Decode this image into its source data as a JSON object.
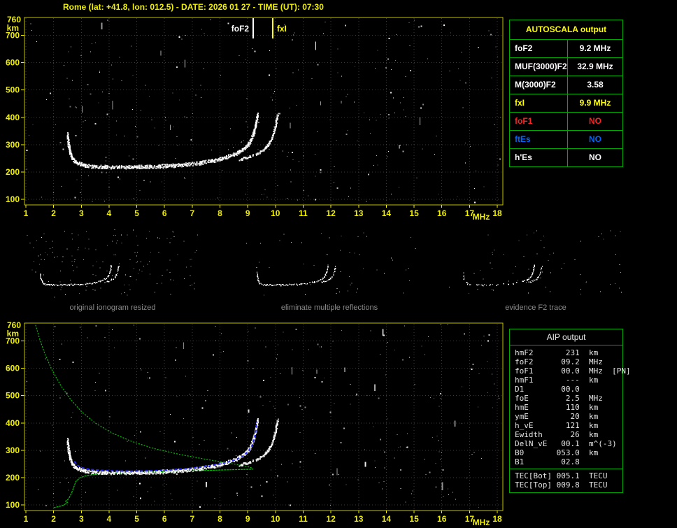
{
  "title": "Rome (lat: +41.8, lon: 012.5) - DATE: 2026 01 27 - TIME (UT): 07:30",
  "colors": {
    "axis": "#f0f000",
    "plot_border": "#c0c000",
    "grid": "#3c3c3c",
    "table_border": "#00aa00",
    "caption": "#8c8c8c",
    "white": "#ffffff",
    "yellow": "#ffff00",
    "red": "#ff2222",
    "blue": "#0066ff",
    "green": "#00c400",
    "blue_curve": "#2a2aff"
  },
  "autoscala_table": {
    "header": "AUTOSCALA output",
    "rows": [
      {
        "label": "foF2",
        "value": "9.2 MHz",
        "color": "white"
      },
      {
        "label": "MUF(3000)F2",
        "value": "32.9 MHz",
        "color": "white"
      },
      {
        "label": "M(3000)F2",
        "value": "3.58",
        "color": "white"
      },
      {
        "label": "fxI",
        "value": "9.9 MHz",
        "color": "yellow"
      },
      {
        "label": "foF1",
        "value": "NO",
        "color": "red"
      },
      {
        "label": "ftEs",
        "value": "NO",
        "color": "blue"
      },
      {
        "label": "h'Es",
        "value": "NO",
        "color": "white"
      }
    ]
  },
  "thumbnails": [
    {
      "caption": "original ionogram resized"
    },
    {
      "caption": "eliminate multiple reflections"
    },
    {
      "caption": "evidence F2 trace"
    }
  ],
  "aip_table": {
    "header": "AIP output",
    "rows": [
      {
        "label": "hmF2",
        "value": "231",
        "unit": "km",
        "extra": ""
      },
      {
        "label": "foF2",
        "value": "09.2",
        "unit": "MHz",
        "extra": ""
      },
      {
        "label": "foF1",
        "value": "00.0",
        "unit": "MHz",
        "extra": "[PN]"
      },
      {
        "label": "hmF1",
        "value": "---",
        "unit": "km",
        "extra": ""
      },
      {
        "label": "D1",
        "value": "00.0",
        "unit": "",
        "extra": ""
      },
      {
        "label": "foE",
        "value": "2.5",
        "unit": "MHz",
        "extra": ""
      },
      {
        "label": "hmE",
        "value": "110",
        "unit": "km",
        "extra": ""
      },
      {
        "label": "ymE",
        "value": "20",
        "unit": "km",
        "extra": ""
      },
      {
        "label": "h_vE",
        "value": "121",
        "unit": "km",
        "extra": ""
      },
      {
        "label": "Ewidth",
        "value": "26",
        "unit": "km",
        "extra": ""
      },
      {
        "label": "DelN_vE",
        "value": "00.1",
        "unit": "m^(-3)",
        "extra": ""
      },
      {
        "label": "B0",
        "value": "053.0",
        "unit": "km",
        "extra": ""
      },
      {
        "label": "B1",
        "value": "02.8",
        "unit": "",
        "extra": ""
      }
    ],
    "tec_rows": [
      {
        "label": "TEC[Bot]",
        "value": "005.1",
        "unit": "TECU"
      },
      {
        "label": "TEC[Top]",
        "value": "009.8",
        "unit": "TECU"
      }
    ]
  },
  "chart_data": {
    "type": "scatter",
    "title": "ionogram",
    "x_axis": {
      "unit": "MHz",
      "min": 1,
      "max": 18,
      "ticks": [
        1,
        2,
        3,
        4,
        5,
        6,
        7,
        8,
        9,
        10,
        11,
        12,
        13,
        14,
        15,
        16,
        17,
        18
      ]
    },
    "y_axis": {
      "unit": "km",
      "top_label": "760",
      "min": 80,
      "max": 765,
      "grid": [
        100,
        200,
        300,
        400,
        500,
        600,
        700
      ]
    },
    "markers": [
      {
        "label": "foF2",
        "mhz": 9.2,
        "color": "white",
        "side": "left"
      },
      {
        "label": "fxI",
        "mhz": 9.9,
        "color": "yellow",
        "side": "right"
      }
    ],
    "series": {
      "o_trace": [
        [
          2.48,
          345
        ],
        [
          2.52,
          310
        ],
        [
          2.58,
          278
        ],
        [
          2.65,
          258
        ],
        [
          2.75,
          245
        ],
        [
          2.9,
          236
        ],
        [
          3.1,
          230
        ],
        [
          3.4,
          227
        ],
        [
          3.8,
          225
        ],
        [
          4.3,
          224
        ],
        [
          4.8,
          224
        ],
        [
          5.3,
          225
        ],
        [
          5.8,
          227
        ],
        [
          6.3,
          230
        ],
        [
          6.8,
          234
        ],
        [
          7.3,
          240
        ],
        [
          7.7,
          247
        ],
        [
          8.0,
          254
        ],
        [
          8.3,
          263
        ],
        [
          8.6,
          275
        ],
        [
          8.8,
          288
        ],
        [
          9.0,
          306
        ],
        [
          9.1,
          322
        ],
        [
          9.2,
          348
        ],
        [
          9.27,
          378
        ],
        [
          9.32,
          405
        ],
        [
          9.34,
          416
        ]
      ],
      "x_trace": [
        [
          8.7,
          250
        ],
        [
          9.0,
          258
        ],
        [
          9.3,
          270
        ],
        [
          9.55,
          285
        ],
        [
          9.7,
          300
        ],
        [
          9.85,
          325
        ],
        [
          9.95,
          358
        ],
        [
          10.02,
          392
        ],
        [
          10.06,
          414
        ]
      ],
      "profile_topside": [
        [
          1.35,
          758
        ],
        [
          1.5,
          706
        ],
        [
          1.7,
          648
        ],
        [
          1.95,
          592
        ],
        [
          2.25,
          538
        ],
        [
          2.6,
          488
        ],
        [
          3.0,
          442
        ],
        [
          3.5,
          400
        ],
        [
          4.1,
          364
        ],
        [
          4.8,
          333
        ],
        [
          5.6,
          307
        ],
        [
          6.5,
          286
        ],
        [
          7.4,
          269
        ],
        [
          8.2,
          255
        ],
        [
          8.8,
          245
        ],
        [
          9.1,
          238
        ],
        [
          9.2,
          232
        ]
      ],
      "profile_bottomside": [
        [
          2.0,
          90
        ],
        [
          2.3,
          97
        ],
        [
          2.45,
          105
        ],
        [
          2.5,
          110
        ],
        [
          2.43,
          114
        ],
        [
          2.47,
          118
        ],
        [
          2.52,
          121
        ],
        [
          2.57,
          128
        ],
        [
          2.64,
          142
        ],
        [
          2.72,
          163
        ],
        [
          2.8,
          186
        ],
        [
          2.95,
          200
        ],
        [
          3.2,
          208
        ],
        [
          3.6,
          213
        ],
        [
          4.2,
          216
        ],
        [
          5.0,
          219
        ],
        [
          6.0,
          222
        ],
        [
          7.0,
          225
        ],
        [
          8.0,
          228
        ],
        [
          8.8,
          230
        ],
        [
          9.2,
          231
        ]
      ],
      "fitted_trace": [
        [
          2.75,
          260
        ],
        [
          2.85,
          246
        ],
        [
          3.0,
          237
        ],
        [
          3.3,
          230
        ],
        [
          3.7,
          227
        ],
        [
          4.2,
          225
        ],
        [
          4.8,
          224
        ],
        [
          5.4,
          225
        ],
        [
          6.0,
          227
        ],
        [
          6.6,
          231
        ],
        [
          7.2,
          237
        ],
        [
          7.7,
          244
        ],
        [
          8.1,
          252
        ],
        [
          8.5,
          263
        ],
        [
          8.8,
          277
        ],
        [
          9.0,
          294
        ],
        [
          9.15,
          316
        ],
        [
          9.25,
          346
        ],
        [
          9.3,
          376
        ],
        [
          9.33,
          405
        ]
      ]
    },
    "render_hints": {
      "top_noise": {
        "seed": 7,
        "dots": 270
      },
      "bottom_noise": {
        "seed": 19,
        "dots": 250
      },
      "thumbs": [
        {
          "seed": 101,
          "dots": 150,
          "skip": 0.1
        },
        {
          "seed": 202,
          "dots": 48,
          "skip": 0.12
        },
        {
          "seed": 303,
          "dots": 62,
          "skip": 0.18,
          "skip_flat": 0.55
        }
      ]
    }
  }
}
